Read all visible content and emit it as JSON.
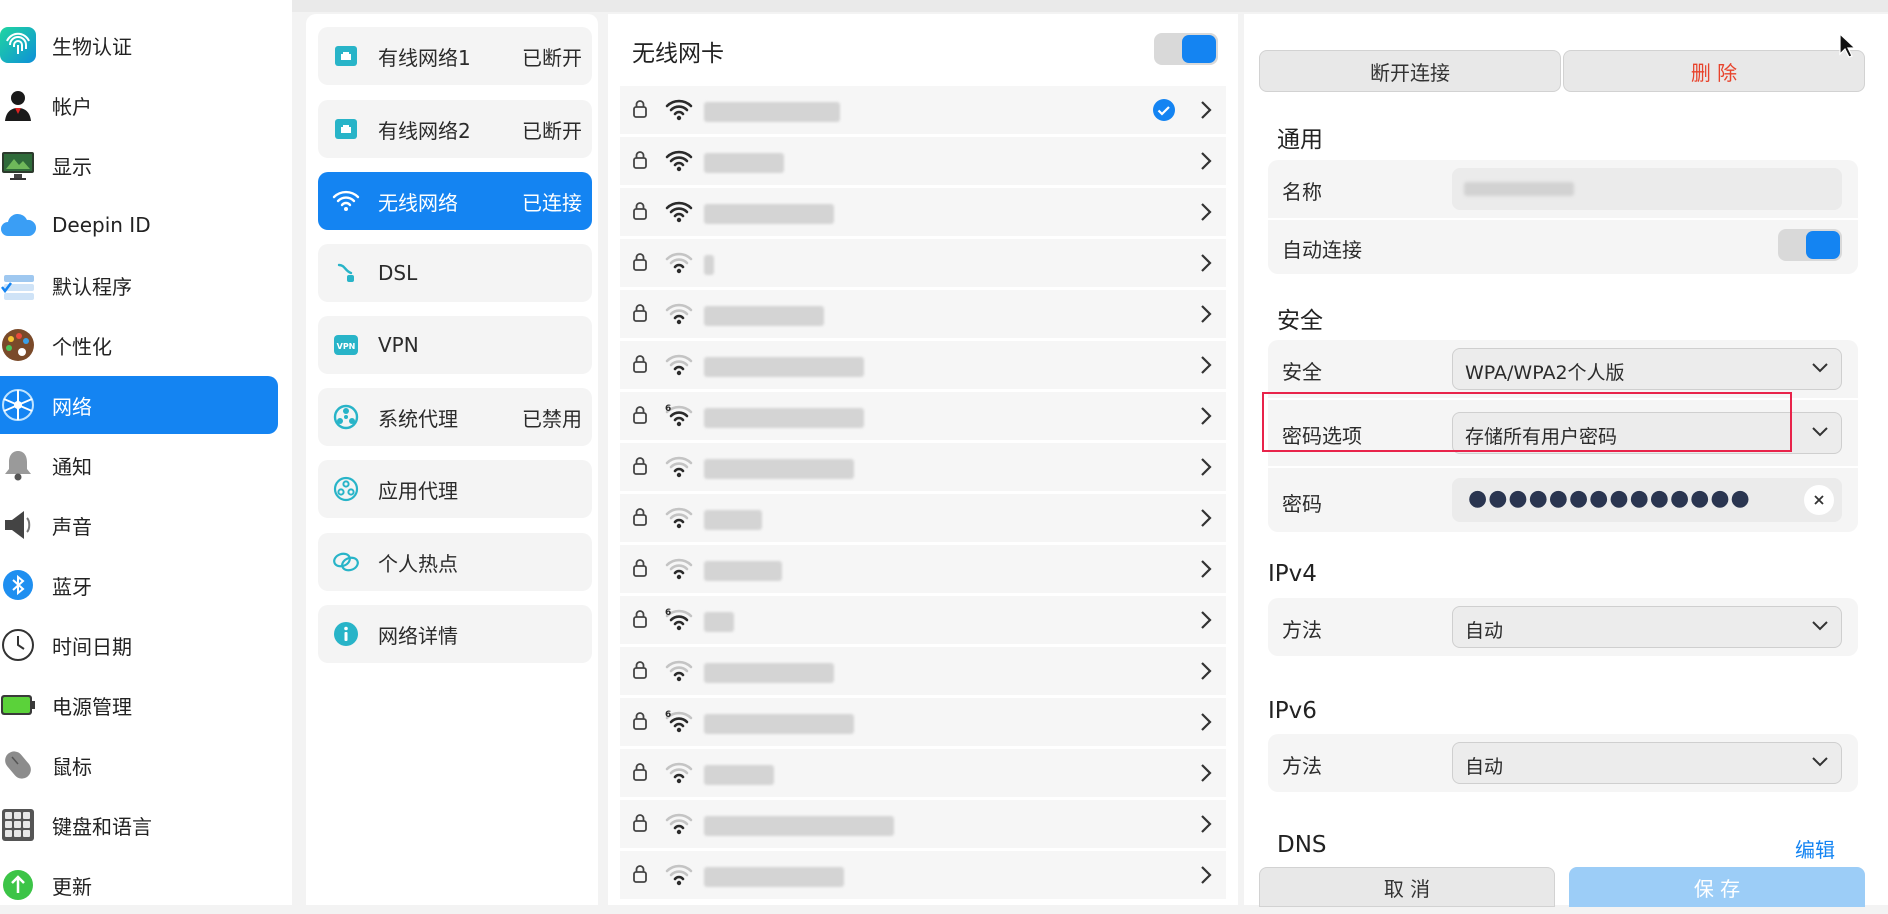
{
  "nav": {
    "items": [
      {
        "label": "生物认证",
        "icon": "fingerprint-icon"
      },
      {
        "label": "帐户",
        "icon": "user-icon"
      },
      {
        "label": "显示",
        "icon": "display-icon"
      },
      {
        "label": "Deepin ID",
        "icon": "cloud-icon"
      },
      {
        "label": "默认程序",
        "icon": "default-apps-icon"
      },
      {
        "label": "个性化",
        "icon": "palette-icon"
      },
      {
        "label": "网络",
        "icon": "network-icon",
        "active": true
      },
      {
        "label": "通知",
        "icon": "bell-icon"
      },
      {
        "label": "声音",
        "icon": "speaker-icon"
      },
      {
        "label": "蓝牙",
        "icon": "bluetooth-icon"
      },
      {
        "label": "时间日期",
        "icon": "clock-icon"
      },
      {
        "label": "电源管理",
        "icon": "battery-icon"
      },
      {
        "label": "鼠标",
        "icon": "mouse-icon"
      },
      {
        "label": "键盘和语言",
        "icon": "keyboard-icon"
      },
      {
        "label": "更新",
        "icon": "update-icon"
      }
    ]
  },
  "network": {
    "categories": [
      {
        "label": "有线网络1",
        "status": "已断开",
        "icon": "ethernet-icon"
      },
      {
        "label": "有线网络2",
        "status": "已断开",
        "icon": "ethernet-icon"
      },
      {
        "label": "无线网络",
        "status": "已连接",
        "icon": "wifi-icon",
        "active": true
      },
      {
        "label": "DSL",
        "status": "",
        "icon": "dsl-icon"
      },
      {
        "label": "VPN",
        "status": "",
        "icon": "vpn-icon"
      },
      {
        "label": "系统代理",
        "status": "已禁用",
        "icon": "proxy-icon"
      },
      {
        "label": "应用代理",
        "status": "",
        "icon": "app-proxy-icon"
      },
      {
        "label": "个人热点",
        "status": "",
        "icon": "hotspot-icon"
      },
      {
        "label": "网络详情",
        "status": "",
        "icon": "info-icon"
      }
    ]
  },
  "wifi": {
    "title": "无线网卡",
    "adapter_enabled": true,
    "networks": [
      {
        "signal": 4,
        "connected": true
      },
      {
        "signal": 4
      },
      {
        "signal": 4
      },
      {
        "signal": 2
      },
      {
        "signal": 2
      },
      {
        "signal": 2
      },
      {
        "signal": 3,
        "wifi6": true
      },
      {
        "signal": 2
      },
      {
        "signal": 2
      },
      {
        "signal": 2
      },
      {
        "signal": 3,
        "wifi6": true
      },
      {
        "signal": 2
      },
      {
        "signal": 3,
        "wifi6": true
      },
      {
        "signal": 2
      },
      {
        "signal": 2
      },
      {
        "signal": 2
      }
    ]
  },
  "detail": {
    "disconnect_label": "断开连接",
    "delete_label": "删 除",
    "general_title": "通用",
    "name_label": "名称",
    "auto_connect_label": "自动连接",
    "auto_connect_enabled": true,
    "security_title": "安全",
    "security_label": "安全",
    "security_value": "WPA/WPA2个人版",
    "password_option_label": "密码选项",
    "password_option_value": "存储所有用户密码",
    "password_label": "密码",
    "password_mask": "●●●●●●●●●●●●●●",
    "ipv4_title": "IPv4",
    "ipv4_method_label": "方法",
    "ipv4_method_value": "自动",
    "ipv6_title": "IPv6",
    "ipv6_method_label": "方法",
    "ipv6_method_value": "自动",
    "dns_title": "DNS",
    "dns_edit_label": "编辑",
    "cancel_label": "取 消",
    "save_label": "保 存"
  },
  "colors": {
    "accent": "#1484f2",
    "danger": "#e8432c",
    "highlight": "#e8234a"
  }
}
